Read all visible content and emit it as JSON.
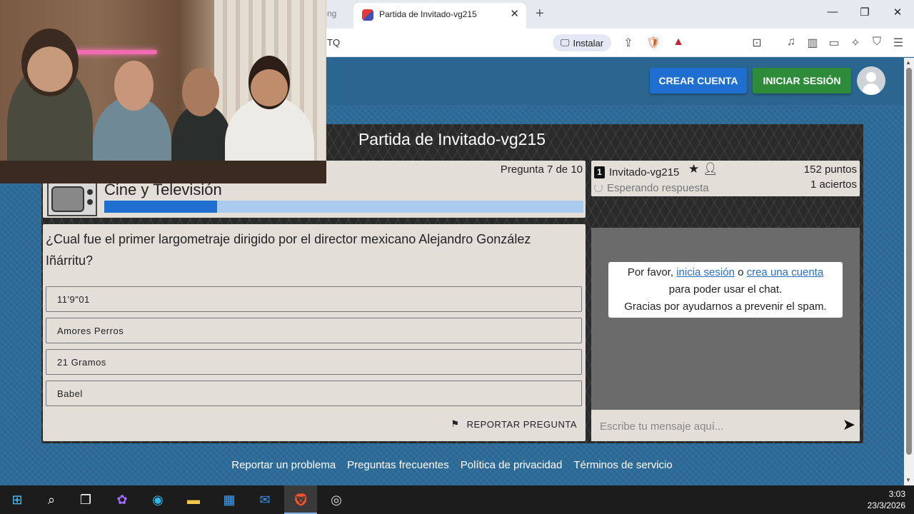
{
  "browser": {
    "active_tab_title": "Partida de Invitado-vg215",
    "prev_tab_fragment": "ng",
    "url_fragment": "TQ",
    "install_label": "Instalar",
    "new_tab_symbol": "+",
    "close_tab_symbol": "✕",
    "win_min": "—",
    "win_max": "❐",
    "win_close": "✕"
  },
  "header": {
    "create_account_label": "CREAR CUENTA",
    "login_label": "INICIAR SESIÓN"
  },
  "game": {
    "title": "Partida de Invitado-vg215",
    "question_counter": "Pregunta 7 de 10",
    "category": "Cine y Televisión",
    "progress": 0.235,
    "question": "¿Cual fue el primer largometraje dirigido por el director mexicano Alejandro González Iñárritu?",
    "answers": [
      "11'9\"01",
      "Amores Perros",
      "21 Gramos",
      "Babel"
    ],
    "report_label": "REPORTAR PREGUNTA"
  },
  "player": {
    "rank": "1",
    "name": "Invitado-vg215",
    "status": "Esperando respuesta",
    "points": "152 puntos",
    "hits": "1 aciertos"
  },
  "chat": {
    "notice_prefix": "Por favor, ",
    "login_link": "inicia sesión",
    "notice_or": " o ",
    "create_link": "crea una cuenta",
    "notice_line2": "para poder usar el chat.",
    "notice_line3": "Gracias por ayudarnos a prevenir el spam.",
    "placeholder": "Escribe tu mensaje aquí..."
  },
  "footer": {
    "links": [
      "Reportar un problema",
      "Preguntas frecuentes",
      "Política de privacidad",
      "Términos de servicio"
    ]
  },
  "taskbar": {
    "time": "3:03",
    "date": "23/3/2026"
  },
  "colors": {
    "create_button": "#1e6fd0",
    "login_button": "#2e8b3a",
    "progress_fill": "#1e6fd0",
    "page_background": "#2d6b98"
  }
}
